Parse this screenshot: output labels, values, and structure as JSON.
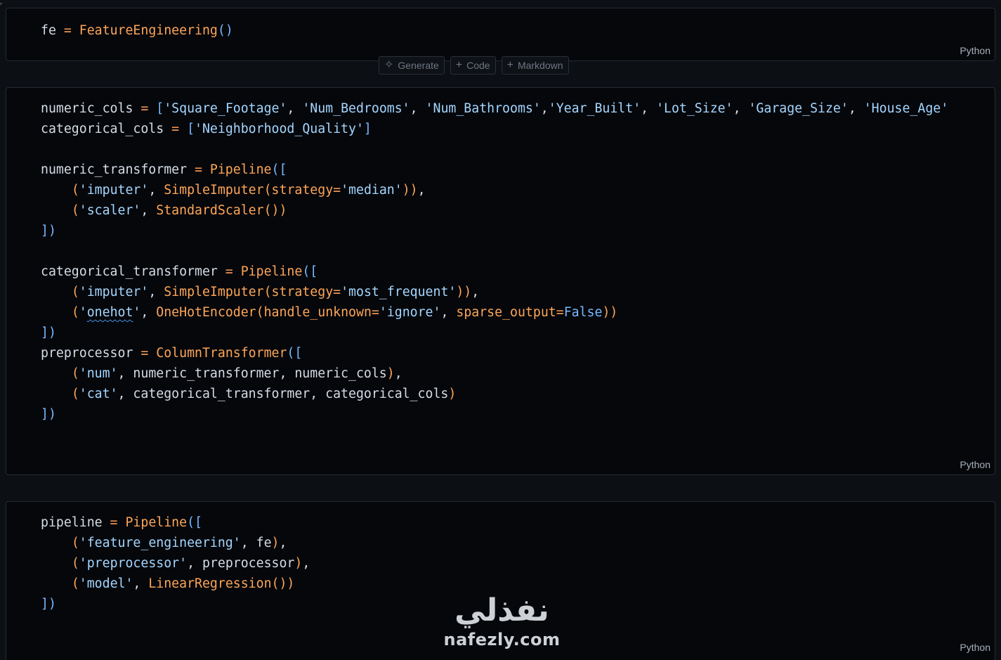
{
  "cells": [
    {
      "language": "Python",
      "lines": [
        [
          [
            "fe",
            "name"
          ],
          [
            " = ",
            "op"
          ],
          [
            "FeatureEngineering",
            "call"
          ],
          [
            "()",
            "brk"
          ]
        ]
      ]
    },
    {
      "language": "Python",
      "lines": [
        [
          [
            "numeric_cols",
            "name"
          ],
          [
            " = ",
            "op"
          ],
          [
            "[",
            "brk"
          ],
          [
            "'Square_Footage'",
            "str"
          ],
          [
            ", ",
            "name"
          ],
          [
            "'Num_Bedrooms'",
            "str"
          ],
          [
            ", ",
            "name"
          ],
          [
            "'Num_Bathrooms'",
            "str"
          ],
          [
            ",",
            "name"
          ],
          [
            "'Year_Built'",
            "str"
          ],
          [
            ", ",
            "name"
          ],
          [
            "'Lot_Size'",
            "str"
          ],
          [
            ", ",
            "name"
          ],
          [
            "'Garage_Size'",
            "str"
          ],
          [
            ", ",
            "name"
          ],
          [
            "'House_Age'",
            "str"
          ]
        ],
        [
          [
            "categorical_cols",
            "name"
          ],
          [
            " = ",
            "op"
          ],
          [
            "[",
            "brk"
          ],
          [
            "'Neighborhood_Quality'",
            "str"
          ],
          [
            "]",
            "brk"
          ]
        ],
        [],
        [
          [
            "numeric_transformer",
            "name"
          ],
          [
            " = ",
            "op"
          ],
          [
            "Pipeline",
            "call"
          ],
          [
            "([",
            "brk"
          ]
        ],
        [
          [
            "    ",
            "name"
          ],
          [
            "(",
            "paren"
          ],
          [
            "'imputer'",
            "str"
          ],
          [
            ", ",
            "name"
          ],
          [
            "SimpleImputer",
            "call"
          ],
          [
            "(",
            "paren"
          ],
          [
            "strategy",
            "call"
          ],
          [
            "=",
            "op"
          ],
          [
            "'median'",
            "str"
          ],
          [
            "))",
            "paren"
          ],
          [
            ",",
            "name"
          ]
        ],
        [
          [
            "    ",
            "name"
          ],
          [
            "(",
            "paren"
          ],
          [
            "'scaler'",
            "str"
          ],
          [
            ", ",
            "name"
          ],
          [
            "StandardScaler",
            "call"
          ],
          [
            "())",
            "paren"
          ]
        ],
        [
          [
            "])",
            "brk"
          ]
        ],
        [],
        [
          [
            "categorical_transformer",
            "name"
          ],
          [
            " = ",
            "op"
          ],
          [
            "Pipeline",
            "call"
          ],
          [
            "([",
            "brk"
          ]
        ],
        [
          [
            "    ",
            "name"
          ],
          [
            "(",
            "paren"
          ],
          [
            "'imputer'",
            "str"
          ],
          [
            ", ",
            "name"
          ],
          [
            "SimpleImputer",
            "call"
          ],
          [
            "(",
            "paren"
          ],
          [
            "strategy",
            "call"
          ],
          [
            "=",
            "op"
          ],
          [
            "'most_frequent'",
            "str"
          ],
          [
            "))",
            "paren"
          ],
          [
            ",",
            "name"
          ]
        ],
        [
          [
            "    ",
            "name"
          ],
          [
            "(",
            "paren"
          ],
          [
            "'",
            "str"
          ],
          [
            "onehot",
            "squig"
          ],
          [
            "'",
            "str"
          ],
          [
            ", ",
            "name"
          ],
          [
            "OneHotEncoder",
            "call"
          ],
          [
            "(",
            "paren"
          ],
          [
            "handle_unknown",
            "call"
          ],
          [
            "=",
            "op"
          ],
          [
            "'ignore'",
            "str"
          ],
          [
            ", ",
            "name"
          ],
          [
            "sparse_output",
            "call"
          ],
          [
            "=",
            "op"
          ],
          [
            "False",
            "kw"
          ],
          [
            "))",
            "paren"
          ]
        ],
        [
          [
            "])",
            "brk"
          ]
        ],
        [
          [
            "preprocessor",
            "name"
          ],
          [
            " = ",
            "op"
          ],
          [
            "ColumnTransformer",
            "call"
          ],
          [
            "([",
            "brk"
          ]
        ],
        [
          [
            "    ",
            "name"
          ],
          [
            "(",
            "paren"
          ],
          [
            "'num'",
            "str"
          ],
          [
            ", numeric_transformer, numeric_cols",
            "name"
          ],
          [
            ")",
            "paren"
          ],
          [
            ",",
            "name"
          ]
        ],
        [
          [
            "    ",
            "name"
          ],
          [
            "(",
            "paren"
          ],
          [
            "'cat'",
            "str"
          ],
          [
            ", categorical_transformer, categorical_cols",
            "name"
          ],
          [
            ")",
            "paren"
          ]
        ],
        [
          [
            "])",
            "brk"
          ]
        ]
      ]
    },
    {
      "language": "Python",
      "lines": [
        [
          [
            "pipeline",
            "name"
          ],
          [
            " = ",
            "op"
          ],
          [
            "Pipeline",
            "call"
          ],
          [
            "([",
            "brk"
          ]
        ],
        [
          [
            "    ",
            "name"
          ],
          [
            "(",
            "paren"
          ],
          [
            "'feature_engineering'",
            "str"
          ],
          [
            ", fe",
            "name"
          ],
          [
            ")",
            "paren"
          ],
          [
            ",",
            "name"
          ]
        ],
        [
          [
            "    ",
            "name"
          ],
          [
            "(",
            "paren"
          ],
          [
            "'preprocessor'",
            "str"
          ],
          [
            ", preprocessor",
            "name"
          ],
          [
            ")",
            "paren"
          ],
          [
            ",",
            "name"
          ]
        ],
        [
          [
            "    ",
            "name"
          ],
          [
            "(",
            "paren"
          ],
          [
            "'model'",
            "str"
          ],
          [
            ", ",
            "name"
          ],
          [
            "LinearRegression",
            "call"
          ],
          [
            "())",
            "paren"
          ]
        ],
        [
          [
            "])",
            "brk"
          ]
        ]
      ]
    }
  ],
  "insert_toolbar": {
    "generate_label": "Generate",
    "code_label": "Code",
    "markdown_label": "Markdown",
    "generate_icon": "sparkle-icon",
    "code_icon": "plus-icon",
    "markdown_icon": "plus-icon"
  },
  "watermark": {
    "arabic": "نفذلي",
    "latin": "nafezly.com"
  },
  "colors": {
    "background": "#0c0f14",
    "cell_background": "#05070b",
    "string": "#a5d6ff",
    "call": "#ffa657",
    "bracket": "#79b8ff",
    "text": "#d6dde6"
  }
}
